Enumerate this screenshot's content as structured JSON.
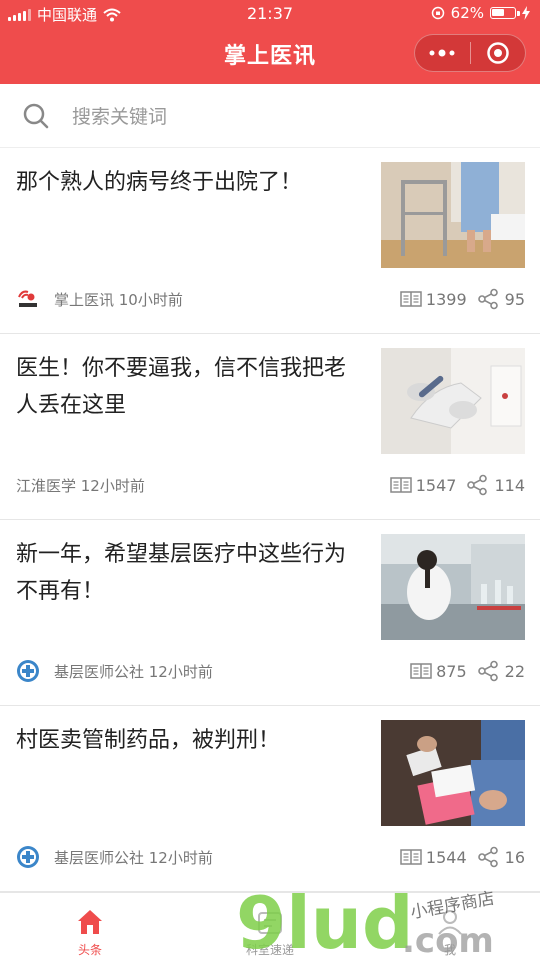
{
  "status_bar": {
    "carrier": "中国联通",
    "time": "21:37",
    "battery_percent": 62,
    "battery_label": "62%"
  },
  "nav": {
    "title": "掌上医讯",
    "capsule_more_icon": "more-dots-icon",
    "capsule_close_icon": "target-close-icon"
  },
  "search": {
    "placeholder": "搜索关键词",
    "icon": "search-icon"
  },
  "articles": [
    {
      "title": "那个熟人的病号终于出院了！",
      "source": "掌上医讯 10小时前",
      "has_logo": true,
      "logo": "zsyx-logo",
      "views": "1399",
      "shares": "95"
    },
    {
      "title": "医生！你不要逼我，信不信我把老人丢在这里",
      "source": "江淮医学 12小时前",
      "has_logo": false,
      "views": "1547",
      "shares": "114"
    },
    {
      "title": "新一年，希望基层医疗中这些行为不再有！",
      "source": "基层医师公社 12小时前",
      "has_logo": true,
      "logo": "jcys-logo",
      "views": "875",
      "shares": "22"
    },
    {
      "title": "村医卖管制药品，被判刑！",
      "source": "基层医师公社 12小时前",
      "has_logo": true,
      "logo": "jcys-logo",
      "views": "1544",
      "shares": "16"
    }
  ],
  "tabbar": {
    "tabs": [
      {
        "label": "头条",
        "icon": "home-icon",
        "active": true
      },
      {
        "label": "科室速递",
        "icon": "department-icon",
        "active": false
      },
      {
        "label": "我",
        "icon": "profile-icon",
        "active": false
      }
    ]
  },
  "watermark": {
    "brand": "9lud",
    "suffix": ".com",
    "tagline": "小程序商店"
  },
  "colors": {
    "accent": "#ef4c4c",
    "text": "#222222",
    "muted": "#777777"
  }
}
